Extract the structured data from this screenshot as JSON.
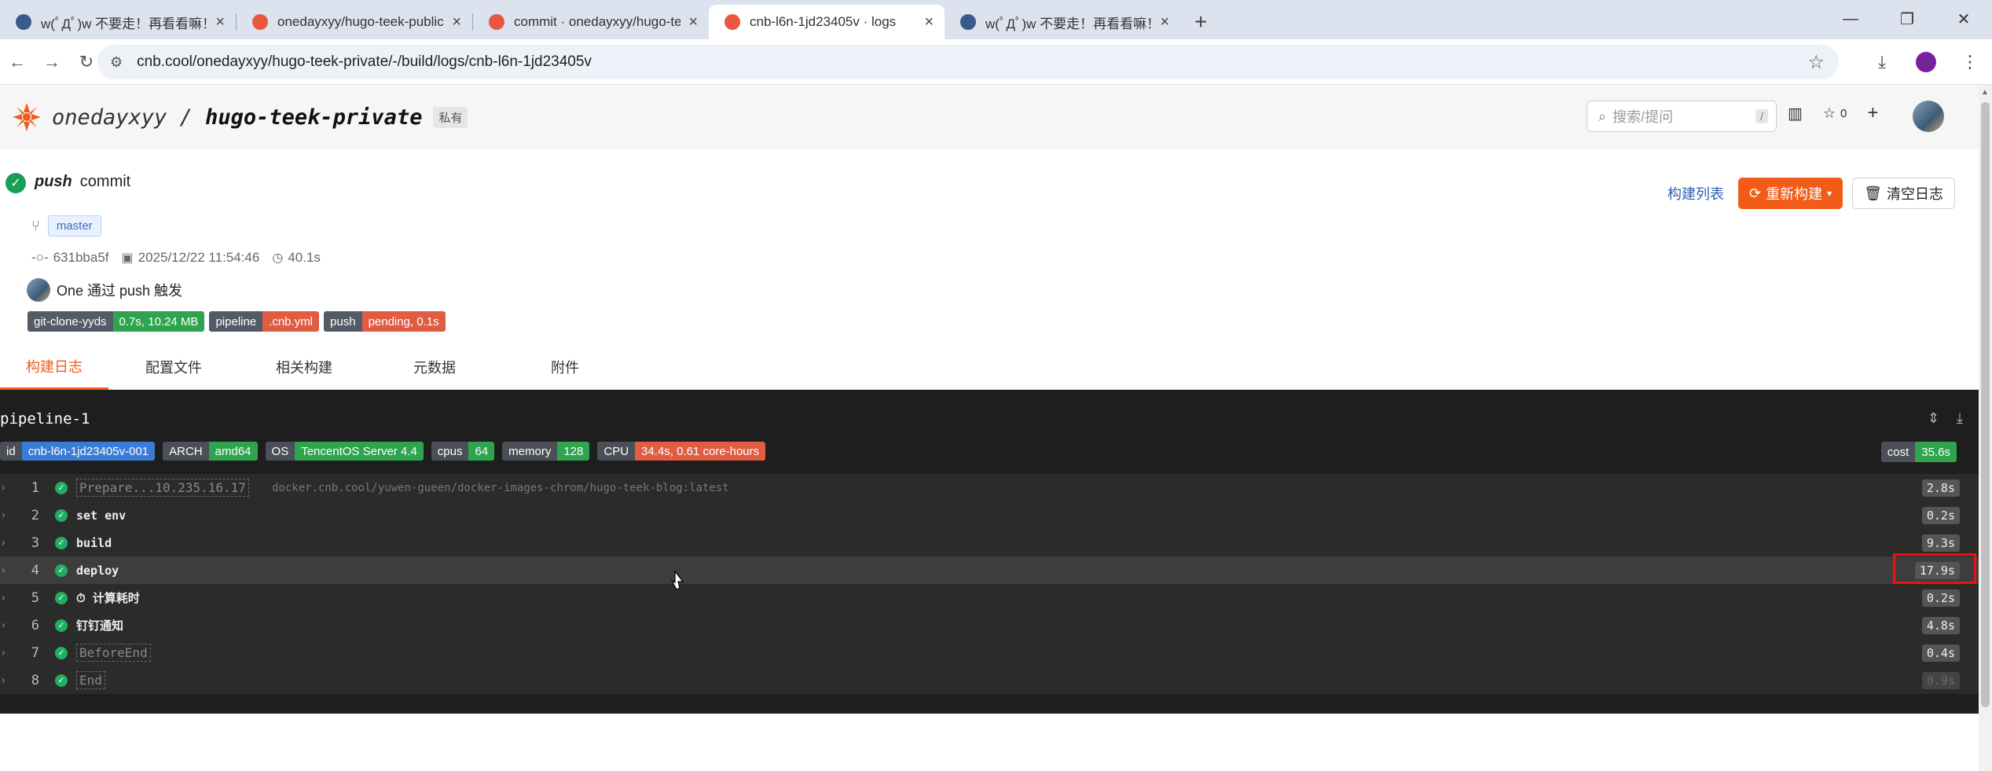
{
  "browser": {
    "tabs": [
      {
        "title": "w(ﾟДﾟ)w 不要走！再看看嘛！",
        "favicon_color": "#3b5a8c",
        "active": false
      },
      {
        "title": "onedayxyy/hugo-teek-public",
        "favicon_color": "#e9573f",
        "active": false
      },
      {
        "title": "commit · onedayxyy/hugo-te",
        "favicon_color": "#e9573f",
        "active": false
      },
      {
        "title": "cnb-l6n-1jd23405v · logs",
        "favicon_color": "#e9573f",
        "active": true
      },
      {
        "title": "w(ﾟДﾟ)w 不要走！再看看嘛！",
        "favicon_color": "#3b5a8c",
        "active": false
      }
    ],
    "url": "cnb.cool/onedayxyy/hugo-teek-private/-/build/logs/cnb-l6n-1jd23405v",
    "profile_initial": "o"
  },
  "header": {
    "owner": "onedayxyy",
    "separator": "/",
    "repo": "hugo-teek-private",
    "visibility": "私有",
    "search_placeholder": "搜索/提问",
    "search_shortcut": "/",
    "star_count": "0"
  },
  "commit": {
    "event": "push",
    "title": "commit",
    "branch": "master",
    "sha": "631bba5f",
    "datetime": "2025/12/22 11:54:46",
    "duration": "40.1s",
    "trigger_text": "One 通过 push 触发",
    "badges": [
      {
        "key": "git-clone-yyds",
        "value": "0.7s, 10.24 MB",
        "color": "#2ea44f"
      },
      {
        "key": "pipeline",
        "value": ".cnb.yml",
        "color": "#e05d44"
      },
      {
        "key": "push",
        "value": "pending, 0.1s",
        "color": "#e05d44"
      }
    ]
  },
  "actions": {
    "build_list": "构建列表",
    "rebuild": "重新构建",
    "clear_log": "清空日志"
  },
  "tabs": [
    "构建日志",
    "配置文件",
    "相关构建",
    "元数据",
    "附件"
  ],
  "pipeline": {
    "name": "pipeline-1",
    "badges": [
      {
        "key": "id",
        "value": "cnb-l6n-1jd23405v-001",
        "color": "#3a7bd5"
      },
      {
        "key": "ARCH",
        "value": "amd64",
        "color": "#2ea44f"
      },
      {
        "key": "OS",
        "value": "TencentOS Server 4.4",
        "color": "#2ea44f"
      },
      {
        "key": "cpus",
        "value": "64",
        "color": "#2ea44f"
      },
      {
        "key": "memory",
        "value": "128",
        "color": "#2ea44f"
      },
      {
        "key": "CPU",
        "value": "34.4s, 0.61 core-hours",
        "color": "#e05d44"
      }
    ],
    "cost": {
      "key": "cost",
      "value": "35.6s",
      "color": "#2ea44f"
    },
    "steps": [
      {
        "num": "1",
        "name": "Prepare...10.235.16.17",
        "extra": "docker.cnb.cool/yuwen-gueen/docker-images-chrom/hugo-teek-blog:latest",
        "dur": "2.8s",
        "dim": true
      },
      {
        "num": "2",
        "name": "set env",
        "extra": "",
        "dur": "0.2s",
        "dim": false
      },
      {
        "num": "3",
        "name": "build",
        "extra": "",
        "dur": "9.3s",
        "dim": false
      },
      {
        "num": "4",
        "name": "deploy",
        "extra": "",
        "dur": "17.9s",
        "dim": false,
        "hover": true,
        "highlight": true
      },
      {
        "num": "5",
        "name": "⏱ 计算耗时",
        "extra": "",
        "dur": "0.2s",
        "dim": false
      },
      {
        "num": "6",
        "name": "钉钉通知",
        "extra": "",
        "dur": "4.8s",
        "dim": false
      },
      {
        "num": "7",
        "name": "BeforeEnd",
        "extra": "",
        "dur": "0.4s",
        "dim": true
      },
      {
        "num": "8",
        "name": "End",
        "extra": "",
        "dur": "0.9s",
        "dim": true,
        "faint": true
      }
    ]
  }
}
